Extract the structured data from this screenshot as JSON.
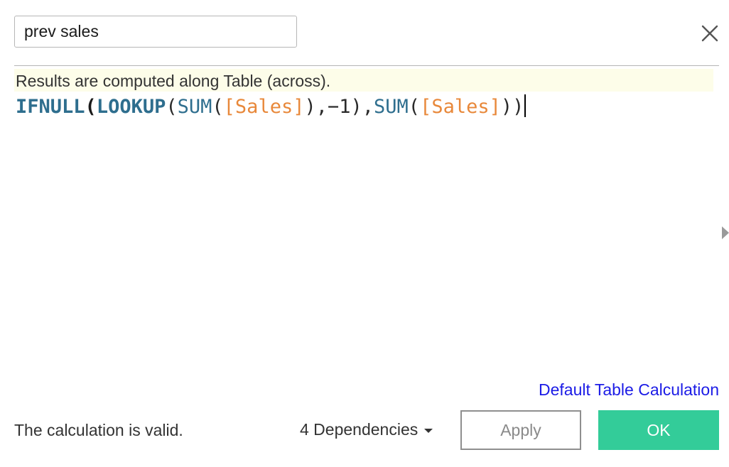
{
  "header": {
    "calc_name_value": "prev sales",
    "close_icon": "close-icon"
  },
  "info": {
    "text": "Results are computed along Table (across)."
  },
  "formula": {
    "tokens": {
      "t1": "IFNULL",
      "t2": "(",
      "t3": "LOOKUP",
      "t4": "(",
      "t5": "SUM",
      "t6": "(",
      "t7": "[Sales]",
      "t8": "),−1),",
      "t9": "SUM",
      "t10": "(",
      "t11": "[Sales]",
      "t12": "))"
    }
  },
  "footer": {
    "default_link": "Default Table Calculation",
    "status": "The calculation is valid.",
    "dependencies": "4 Dependencies",
    "apply_label": "Apply",
    "ok_label": "OK"
  },
  "colors": {
    "ok_button": "#33cc99",
    "function": "#2e6e8e",
    "field": "#e8883a",
    "link": "#1b1be6",
    "info_bg": "#fdfde9"
  }
}
